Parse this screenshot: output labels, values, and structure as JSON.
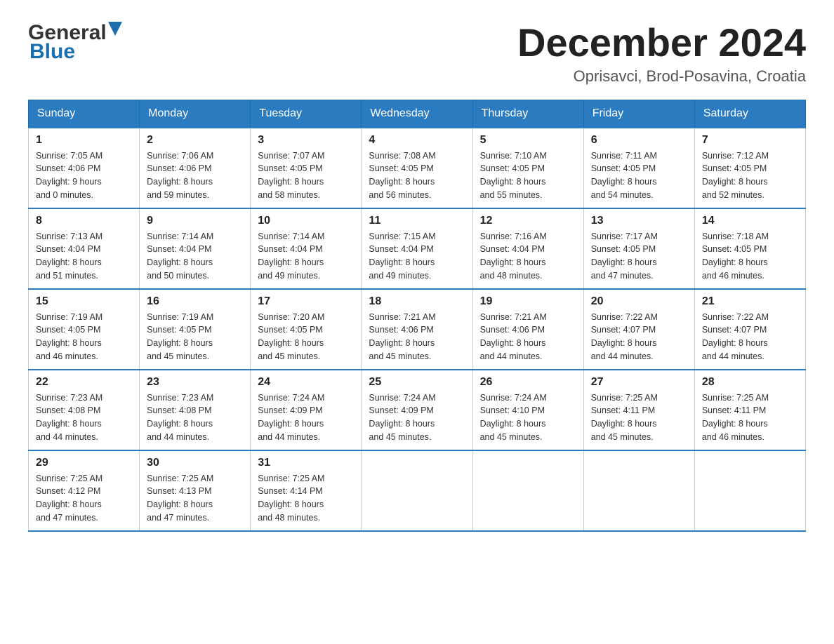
{
  "header": {
    "logo_line1": "General",
    "logo_line2": "Blue",
    "month": "December 2024",
    "location": "Oprisavci, Brod-Posavina, Croatia"
  },
  "days_of_week": [
    "Sunday",
    "Monday",
    "Tuesday",
    "Wednesday",
    "Thursday",
    "Friday",
    "Saturday"
  ],
  "weeks": [
    [
      {
        "day": "1",
        "sunrise": "7:05 AM",
        "sunset": "4:06 PM",
        "daylight": "9 hours and 0 minutes."
      },
      {
        "day": "2",
        "sunrise": "7:06 AM",
        "sunset": "4:06 PM",
        "daylight": "8 hours and 59 minutes."
      },
      {
        "day": "3",
        "sunrise": "7:07 AM",
        "sunset": "4:05 PM",
        "daylight": "8 hours and 58 minutes."
      },
      {
        "day": "4",
        "sunrise": "7:08 AM",
        "sunset": "4:05 PM",
        "daylight": "8 hours and 56 minutes."
      },
      {
        "day": "5",
        "sunrise": "7:10 AM",
        "sunset": "4:05 PM",
        "daylight": "8 hours and 55 minutes."
      },
      {
        "day": "6",
        "sunrise": "7:11 AM",
        "sunset": "4:05 PM",
        "daylight": "8 hours and 54 minutes."
      },
      {
        "day": "7",
        "sunrise": "7:12 AM",
        "sunset": "4:05 PM",
        "daylight": "8 hours and 52 minutes."
      }
    ],
    [
      {
        "day": "8",
        "sunrise": "7:13 AM",
        "sunset": "4:04 PM",
        "daylight": "8 hours and 51 minutes."
      },
      {
        "day": "9",
        "sunrise": "7:14 AM",
        "sunset": "4:04 PM",
        "daylight": "8 hours and 50 minutes."
      },
      {
        "day": "10",
        "sunrise": "7:14 AM",
        "sunset": "4:04 PM",
        "daylight": "8 hours and 49 minutes."
      },
      {
        "day": "11",
        "sunrise": "7:15 AM",
        "sunset": "4:04 PM",
        "daylight": "8 hours and 49 minutes."
      },
      {
        "day": "12",
        "sunrise": "7:16 AM",
        "sunset": "4:04 PM",
        "daylight": "8 hours and 48 minutes."
      },
      {
        "day": "13",
        "sunrise": "7:17 AM",
        "sunset": "4:05 PM",
        "daylight": "8 hours and 47 minutes."
      },
      {
        "day": "14",
        "sunrise": "7:18 AM",
        "sunset": "4:05 PM",
        "daylight": "8 hours and 46 minutes."
      }
    ],
    [
      {
        "day": "15",
        "sunrise": "7:19 AM",
        "sunset": "4:05 PM",
        "daylight": "8 hours and 46 minutes."
      },
      {
        "day": "16",
        "sunrise": "7:19 AM",
        "sunset": "4:05 PM",
        "daylight": "8 hours and 45 minutes."
      },
      {
        "day": "17",
        "sunrise": "7:20 AM",
        "sunset": "4:05 PM",
        "daylight": "8 hours and 45 minutes."
      },
      {
        "day": "18",
        "sunrise": "7:21 AM",
        "sunset": "4:06 PM",
        "daylight": "8 hours and 45 minutes."
      },
      {
        "day": "19",
        "sunrise": "7:21 AM",
        "sunset": "4:06 PM",
        "daylight": "8 hours and 44 minutes."
      },
      {
        "day": "20",
        "sunrise": "7:22 AM",
        "sunset": "4:07 PM",
        "daylight": "8 hours and 44 minutes."
      },
      {
        "day": "21",
        "sunrise": "7:22 AM",
        "sunset": "4:07 PM",
        "daylight": "8 hours and 44 minutes."
      }
    ],
    [
      {
        "day": "22",
        "sunrise": "7:23 AM",
        "sunset": "4:08 PM",
        "daylight": "8 hours and 44 minutes."
      },
      {
        "day": "23",
        "sunrise": "7:23 AM",
        "sunset": "4:08 PM",
        "daylight": "8 hours and 44 minutes."
      },
      {
        "day": "24",
        "sunrise": "7:24 AM",
        "sunset": "4:09 PM",
        "daylight": "8 hours and 44 minutes."
      },
      {
        "day": "25",
        "sunrise": "7:24 AM",
        "sunset": "4:09 PM",
        "daylight": "8 hours and 45 minutes."
      },
      {
        "day": "26",
        "sunrise": "7:24 AM",
        "sunset": "4:10 PM",
        "daylight": "8 hours and 45 minutes."
      },
      {
        "day": "27",
        "sunrise": "7:25 AM",
        "sunset": "4:11 PM",
        "daylight": "8 hours and 45 minutes."
      },
      {
        "day": "28",
        "sunrise": "7:25 AM",
        "sunset": "4:11 PM",
        "daylight": "8 hours and 46 minutes."
      }
    ],
    [
      {
        "day": "29",
        "sunrise": "7:25 AM",
        "sunset": "4:12 PM",
        "daylight": "8 hours and 47 minutes."
      },
      {
        "day": "30",
        "sunrise": "7:25 AM",
        "sunset": "4:13 PM",
        "daylight": "8 hours and 47 minutes."
      },
      {
        "day": "31",
        "sunrise": "7:25 AM",
        "sunset": "4:14 PM",
        "daylight": "8 hours and 48 minutes."
      },
      null,
      null,
      null,
      null
    ]
  ]
}
